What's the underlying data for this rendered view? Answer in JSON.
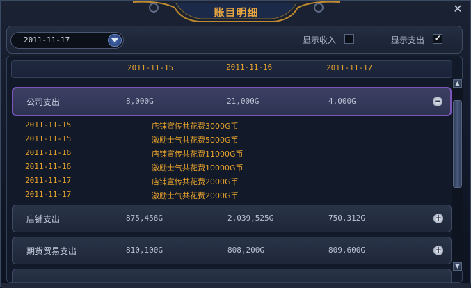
{
  "window": {
    "title": "账目明细"
  },
  "toolbar": {
    "date_value": "2011-11-17",
    "show_income_label": "显示收入",
    "show_income_checked": false,
    "show_expense_label": "显示支出",
    "show_expense_checked": true
  },
  "columns": [
    "2011-11-15",
    "2011-11-16",
    "2011-11-17"
  ],
  "categories": [
    {
      "name": "公司支出",
      "values": [
        "8,000G",
        "21,000G",
        "4,000G"
      ],
      "expanded": true,
      "toggle": "−",
      "details": [
        {
          "date": "2011-11-15",
          "desc": "店铺宣传共花费3000G币"
        },
        {
          "date": "2011-11-15",
          "desc": "激励士气共花费5000G币"
        },
        {
          "date": "2011-11-16",
          "desc": "店铺宣传共花费11000G币"
        },
        {
          "date": "2011-11-16",
          "desc": "激励士气共花费10000G币"
        },
        {
          "date": "2011-11-17",
          "desc": "店铺宣传共花费2000G币"
        },
        {
          "date": "2011-11-17",
          "desc": "激励士气共花费2000G币"
        }
      ]
    },
    {
      "name": "店铺支出",
      "values": [
        "875,456G",
        "2,039,525G",
        "750,312G"
      ],
      "expanded": false,
      "toggle": "+"
    },
    {
      "name": "期货贸易支出",
      "values": [
        "810,100G",
        "808,200G",
        "809,600G"
      ],
      "expanded": false,
      "toggle": "+"
    }
  ],
  "colors": {
    "accent": "#e6a12c",
    "expanded_border": "#7b55b8"
  },
  "icons": {
    "close": "close-icon",
    "dropdown": "chevron-down-icon",
    "scroll_up": "arrow-up-icon",
    "scroll_down": "arrow-down-icon"
  }
}
